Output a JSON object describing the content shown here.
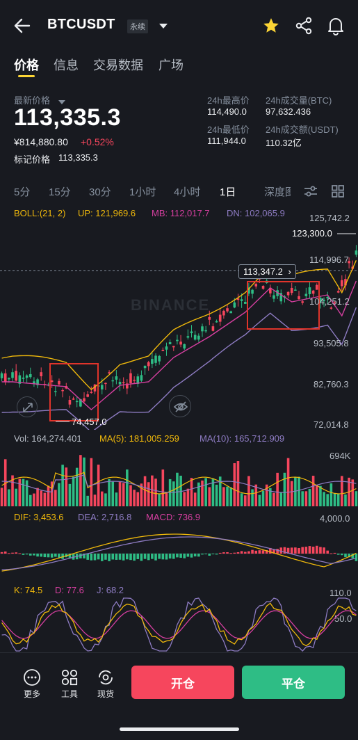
{
  "header": {
    "symbol": "BTCUSDT",
    "contract_type": "永续"
  },
  "tabs": [
    "价格",
    "信息",
    "交易数据",
    "广场"
  ],
  "price": {
    "label": "最新价格",
    "last": "113,335.3",
    "cny": "¥814,880.80",
    "change": "+0.52%",
    "mark_label": "标记价格",
    "mark": "113,335.3"
  },
  "stats": {
    "high_label": "24h最高价",
    "high": "114,490.0",
    "vol_btc_label": "24h成交量(BTC)",
    "vol_btc": "97,632.436",
    "low_label": "24h最低价",
    "low": "111,944.0",
    "vol_usdt_label": "24h成交额(USDT)",
    "vol_usdt": "110.32亿"
  },
  "intervals": [
    "5分",
    "15分",
    "30分",
    "1小时",
    "4小时",
    "1日",
    "深度图"
  ],
  "active_interval": "1日",
  "boll": {
    "label": "BOLL:(21, 2)",
    "up": "UP: 121,969.6",
    "mb": "MB: 112,017.7",
    "dn": "DN: 102,065.9"
  },
  "price_axis": [
    "125,742.2",
    "114,996.7",
    "104,251.2",
    "93,505.8",
    "82,760.3",
    "72,014.8"
  ],
  "chart_annotations": {
    "high_marker": "123,300.0",
    "low_marker": "74,457.0",
    "current_tag": "113,347.2"
  },
  "volume": {
    "vol": "Vol: 164,274.401",
    "ma5": "MA(5): 181,005.259",
    "ma10": "MA(10): 165,712.909",
    "axis_top": "694K"
  },
  "macd": {
    "dif": "DIF: 3,453.6",
    "dea": "DEA: 2,716.8",
    "macd": "MACD: 736.9",
    "axis_top": "4,000.0"
  },
  "kdj": {
    "k": "K: 74.5",
    "d": "D: 77.6",
    "j": "J: 68.2",
    "axis_top": "110.0",
    "axis_mid": "50.0"
  },
  "bottom_bar": {
    "more": "更多",
    "tools": "工具",
    "spot": "现货",
    "open": "开仓",
    "close": "平仓"
  },
  "watermark": "BINANCE",
  "colors": {
    "up": "#2ebd85",
    "down": "#f6465d",
    "accent": "#fcd535",
    "boll_up": "#f0b90b",
    "boll_mb": "#d63fa0",
    "boll_dn": "#8e7cc3"
  }
}
